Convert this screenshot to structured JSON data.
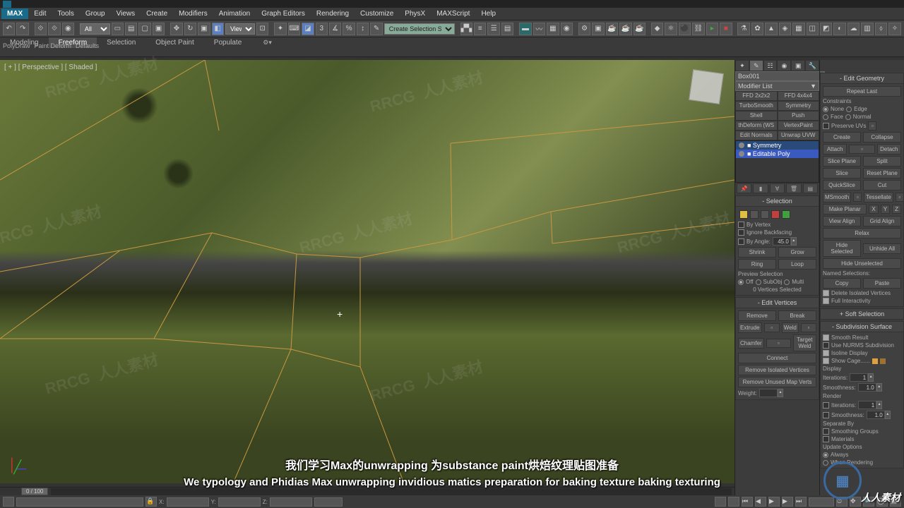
{
  "menus": [
    "Edit",
    "Tools",
    "Group",
    "Views",
    "Create",
    "Modifiers",
    "Animation",
    "Graph Editors",
    "Rendering",
    "Customize",
    "PhysX",
    "MAXScript",
    "Help"
  ],
  "toolbar": {
    "selset": "All",
    "dd2": "View",
    "create_sel": "Create Selection Se"
  },
  "ribbon": {
    "tabs": [
      "Modeling",
      "Freeform",
      "Selection",
      "Object Paint",
      "Populate"
    ],
    "active": 1,
    "sub": [
      "PolyDraw",
      "Paint Deform",
      "Defaults"
    ]
  },
  "viewport": {
    "label": "[ + ] [ Perspective ] [ Shaded ]"
  },
  "timeline": {
    "pos": "0 / 100"
  },
  "object": {
    "name": "Box001",
    "modlist": "Modifier List"
  },
  "mod_buttons": [
    [
      "FFD 2x2x2",
      "FFD 4x4x4"
    ],
    [
      "TurboSmooth",
      "Symmetry"
    ],
    [
      "Shell",
      "Push"
    ],
    [
      "thDeform (WS",
      "VertexPaint"
    ],
    [
      "Edit Normals",
      "Unwrap UVW"
    ]
  ],
  "mod_stack": [
    {
      "label": "Symmetry",
      "hl": "hl-blue"
    },
    {
      "label": "Editable Poly",
      "hl": "hl-blue2"
    }
  ],
  "selection": {
    "title": "Selection",
    "by_vertex": "By Vertex",
    "ignore_backfacing": "Ignore Backfacing",
    "by_angle": "By Angle:",
    "angle_val": "45.0",
    "shrink": "Shrink",
    "grow": "Grow",
    "ring": "Ring",
    "loop": "Loop",
    "preview": "Preview Selection",
    "off": "Off",
    "subobj": "SubObj",
    "multi": "Multi",
    "count": "0 Vertices Selected"
  },
  "edit_vertices": {
    "title": "Edit Vertices",
    "remove": "Remove",
    "break": "Break",
    "extrude": "Extrude",
    "weld": "Weld",
    "chamfer": "Chamfer",
    "target_weld": "Target Weld",
    "connect": "Connect",
    "riv": "Remove Isolated Vertices",
    "rum": "Remove Unused Map Verts",
    "weight": "Weight:",
    "weight_val": ""
  },
  "edit_geom": {
    "title": "Edit Geometry",
    "repeat": "Repeat Last",
    "constraints": "Constraints",
    "none": "None",
    "edge": "Edge",
    "face": "Face",
    "normal": "Normal",
    "preserve": "Preserve UVs",
    "create": "Create",
    "collapse": "Collapse",
    "attach": "Attach",
    "detach": "Detach",
    "slice_plane": "Slice Plane",
    "split": "Split",
    "slice": "Slice",
    "reset_plane": "Reset Plane",
    "quickslice": "QuickSlice",
    "cut": "Cut",
    "msmooth": "MSmooth",
    "tessellate": "Tessellate",
    "make_planar": "Make Planar",
    "x": "X",
    "y": "Y",
    "z": "Z",
    "view_align": "View Align",
    "grid_align": "Grid Align",
    "relax": "Relax",
    "hide_sel": "Hide Selected",
    "unhide": "Unhide All",
    "hide_un": "Hide Unselected",
    "named": "Named Selections:",
    "copy": "Copy",
    "paste": "Paste",
    "del_iso": "Delete Isolated Vertices",
    "full_int": "Full Interactivity"
  },
  "soft_sel": {
    "title": "Soft Selection"
  },
  "subsurf": {
    "title": "Subdivision Surface",
    "smooth_result": "Smooth Result",
    "nurms": "Use NURMS Subdivision",
    "isoline": "Isoline Display",
    "show_cage": "Show Cage......",
    "display": "Display",
    "iter": "Iterations:",
    "iter_val": "1",
    "smooth": "Smoothness:",
    "smooth_val": "1.0",
    "render": "Render",
    "iter2": "Iterations:",
    "iter2_val": "1",
    "smooth2": "Smoothness:",
    "smooth2_val": "1.0",
    "sep": "Separate By",
    "sg": "Smoothing Groups",
    "mat": "Materials",
    "upd": "Update Options",
    "always": "Always",
    "when": "When Rendering"
  },
  "subtitles": {
    "cn": "我们学习Max的unwrapping 为substance paint烘焙纹理贴图准备",
    "en": "We typology and Phidias Max unwrapping invidious matics preparation for baking texture baking texturing"
  },
  "watermark": "RRCG",
  "watermark_sub": "人人素材",
  "brand": "人人素材"
}
